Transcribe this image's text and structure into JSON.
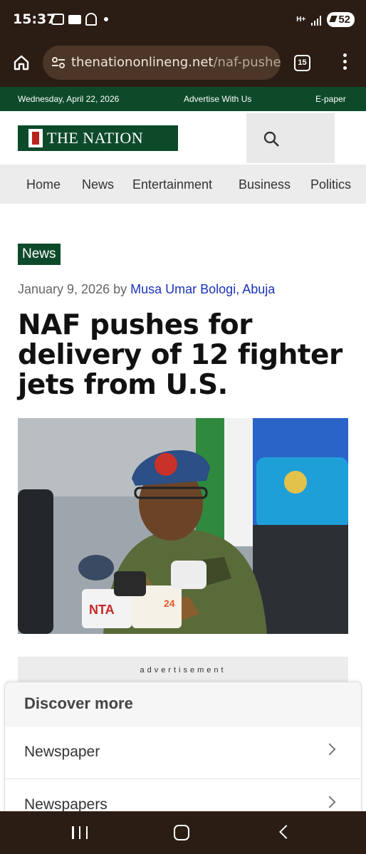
{
  "status_bar": {
    "time": "15:37",
    "battery": "52",
    "network": "H+"
  },
  "browser": {
    "url_host": "thenationonlineng.net",
    "url_path": "/naf-pushes",
    "tab_count": "15"
  },
  "site": {
    "date": "Wednesday, April 22, 2026",
    "advertise": "Advertise With Us",
    "epaper": "E-paper",
    "logo_text": "THE NATION",
    "nav": [
      "Home",
      "News",
      "Entertainment",
      "Business",
      "Politics"
    ]
  },
  "article": {
    "category": "News",
    "date": "January 9, 2026",
    "by": "by",
    "author": "Musa Umar Bologi, Abuja",
    "headline": "NAF pushes for delivery of 12 fighter jets from U.S.",
    "photo_mic_label": "NTA",
    "photo_mic_label_2": "24"
  },
  "ad_label": "advertisement",
  "discover": {
    "title": "Discover more",
    "items": [
      "Newspaper",
      "Newspapers"
    ]
  },
  "colors": {
    "brand_green": "#0d4a2a",
    "browser_chrome": "#2b1d14",
    "author_link": "#1a33b8"
  }
}
